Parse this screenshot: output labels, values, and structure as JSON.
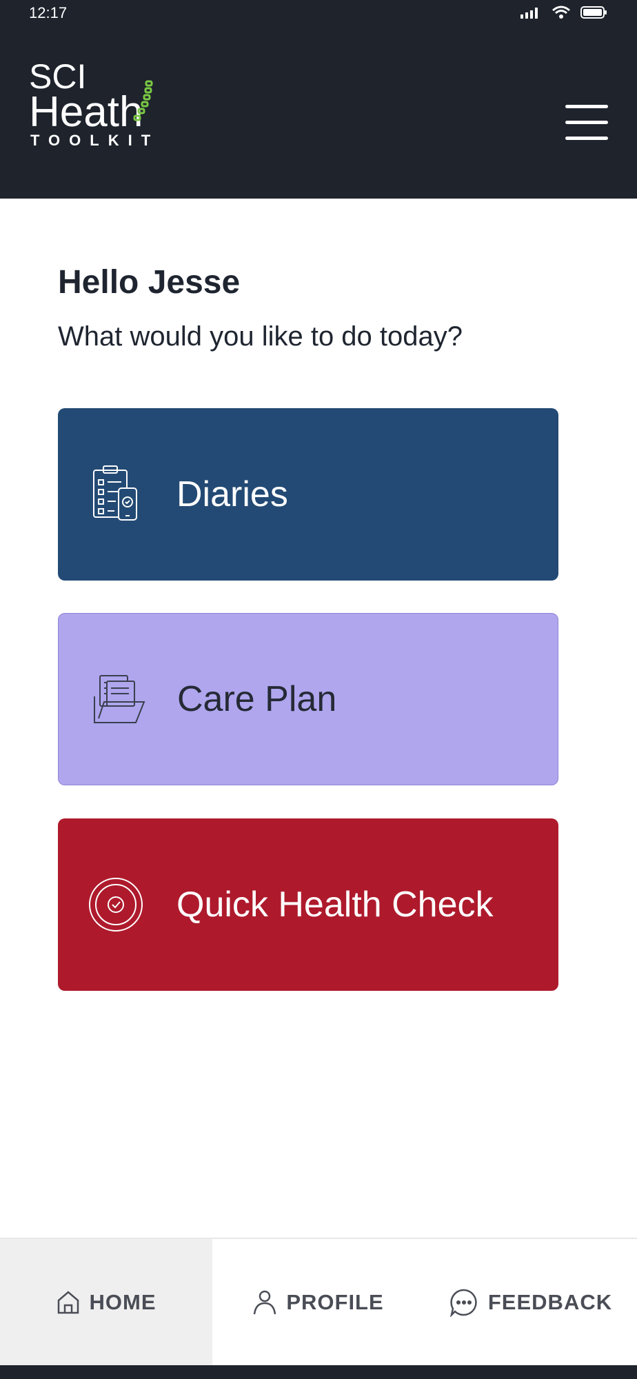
{
  "status_bar": {
    "time": "12:17"
  },
  "logo": {
    "line1": "SCI",
    "line2": "Heath",
    "line3": "TOOLKIT"
  },
  "header": {
    "menu_icon": "hamburger-menu-icon"
  },
  "main": {
    "greeting": "Hello Jesse",
    "prompt": "What would you like to do today?",
    "cards": [
      {
        "label": "Diaries",
        "icon": "clipboard-phone-icon",
        "color": "#234a74"
      },
      {
        "label": "Care Plan",
        "icon": "folder-documents-icon",
        "color": "#afa6ee"
      },
      {
        "label": "Quick Health Check",
        "icon": "check-circle-icon",
        "color": "#ae1a2c"
      }
    ]
  },
  "bottom_nav": {
    "items": [
      {
        "label": "HOME",
        "icon": "home-icon",
        "active": true
      },
      {
        "label": "PROFILE",
        "icon": "person-icon",
        "active": false
      },
      {
        "label": "FEEDBACK",
        "icon": "chat-bubble-icon",
        "active": false
      }
    ]
  },
  "colors": {
    "header_bg": "#1e232c",
    "accent_green": "#7ac943"
  }
}
